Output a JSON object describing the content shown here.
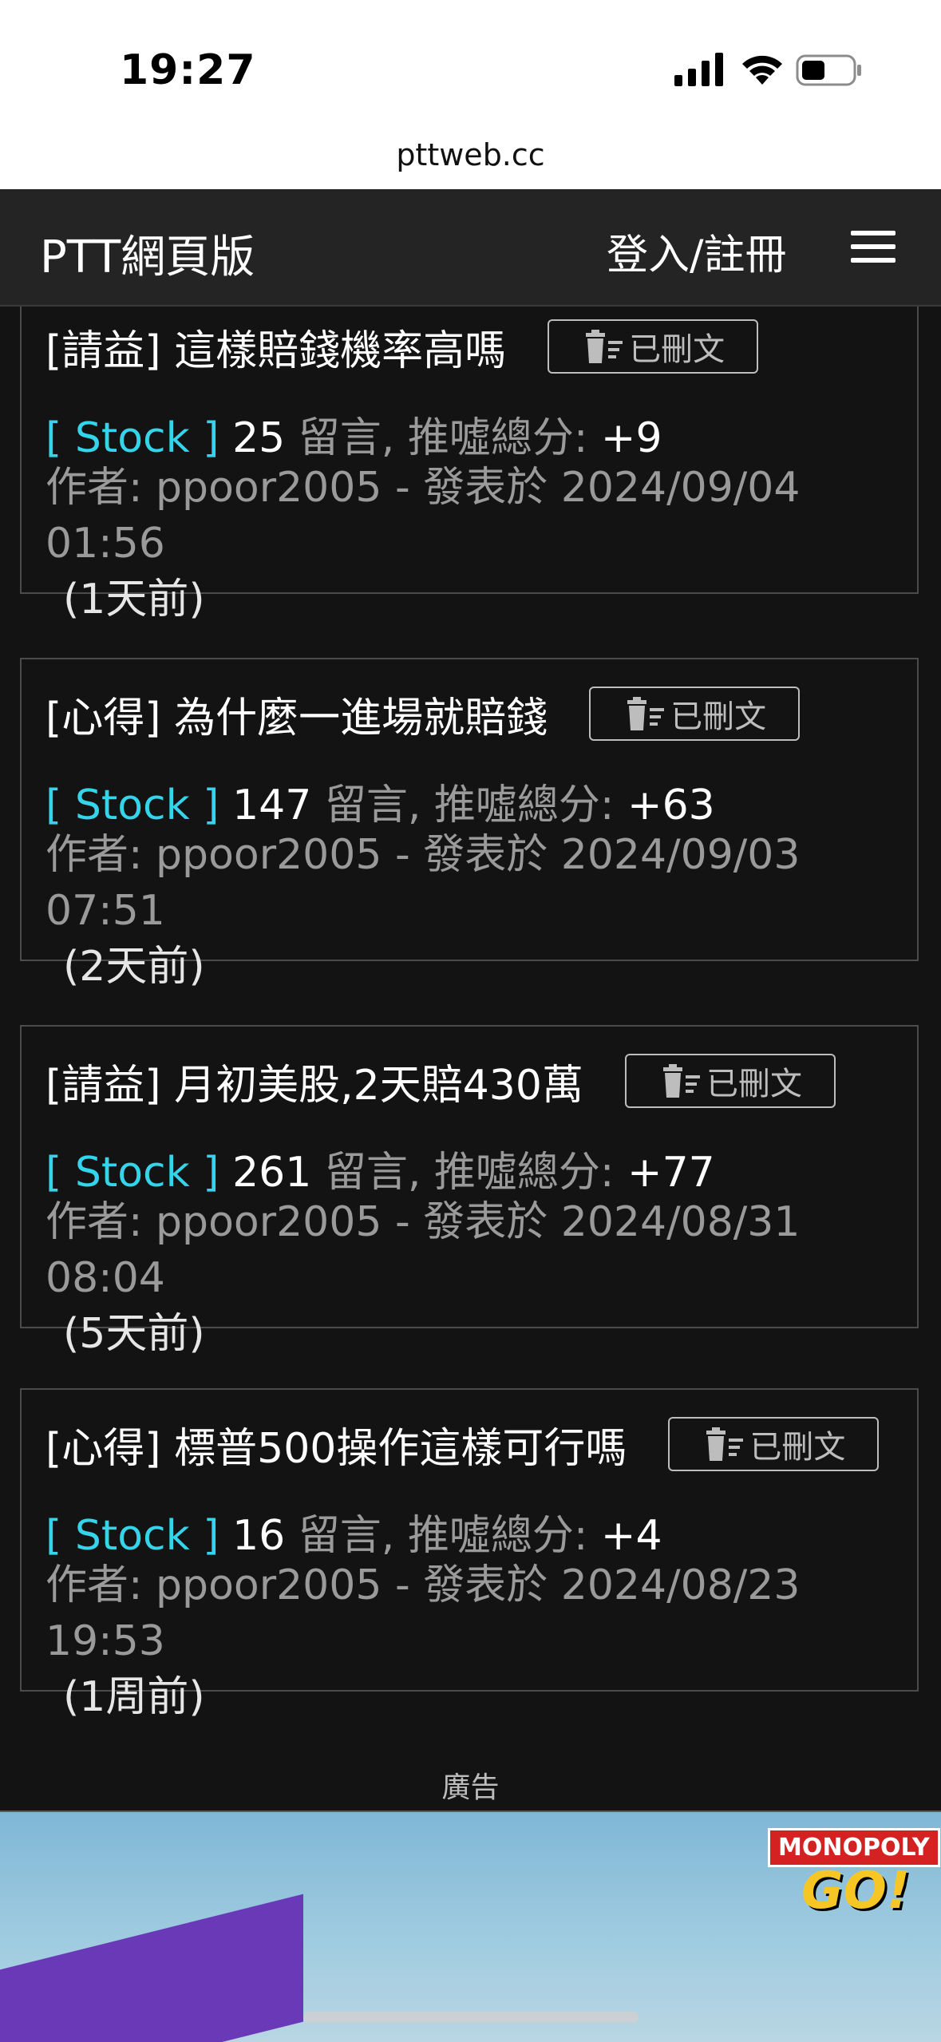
{
  "status_bar": {
    "time": "19:27",
    "url": "pttweb.cc"
  },
  "header": {
    "brand": "PTT網頁版",
    "login": "登入/註冊"
  },
  "deleted_label": "已刪文",
  "posts": [
    {
      "title": "[請益] 這樣賠錢機率高嗎",
      "board": "[ Stock ]",
      "comments": "25",
      "label": "留言, 推噓總分:",
      "score": "+9",
      "author": "作者: ppoor2005 - 發表於 2024/09/04 01:56",
      "ago": "(1天前)"
    },
    {
      "title": "[心得] 為什麼一進場就賠錢",
      "board": "[ Stock ]",
      "comments": "147",
      "label": "留言, 推噓總分:",
      "score": "+63",
      "author": "作者: ppoor2005 - 發表於 2024/09/03 07:51",
      "ago": "(2天前)"
    },
    {
      "title": "[請益] 月初美股,2天賠430萬",
      "board": "[ Stock ]",
      "comments": "261",
      "label": "留言, 推噓總分:",
      "score": "+77",
      "author": "作者: ppoor2005 - 發表於 2024/08/31 08:04",
      "ago": "(5天前)"
    },
    {
      "title": "[心得] 標普500操作這樣可行嗎",
      "board": "[ Stock ]",
      "comments": "16",
      "label": "留言, 推噓總分:",
      "score": "+4",
      "author": "作者: ppoor2005 - 發表於 2024/08/23 19:53",
      "ago": "(1周前)"
    }
  ],
  "ad": {
    "label": "廣告",
    "brand_top": "MONOPOLY",
    "brand_bottom": "GO!"
  }
}
